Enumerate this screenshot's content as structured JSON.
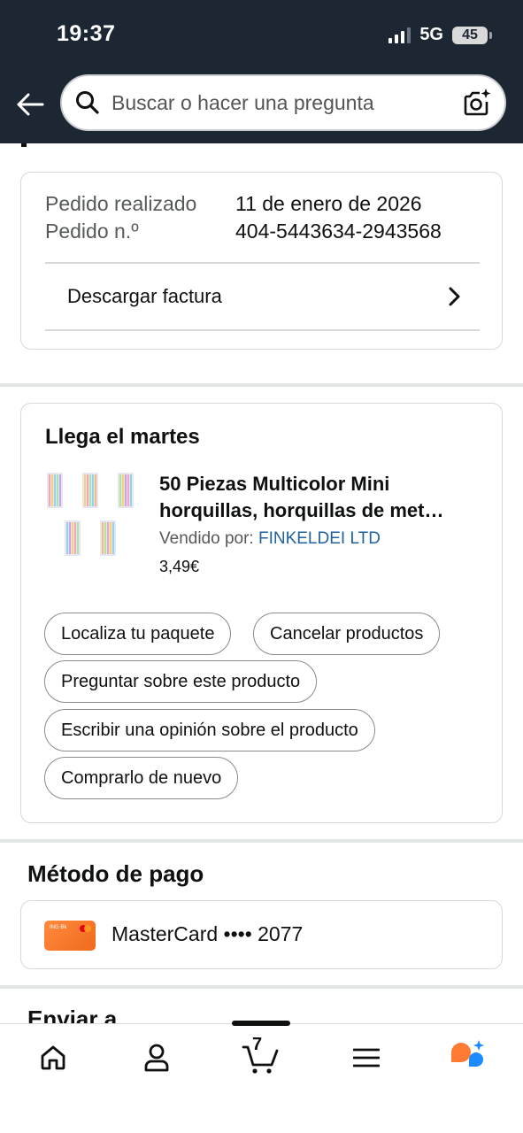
{
  "status_bar": {
    "time": "19:37",
    "network": "5G",
    "battery": "45"
  },
  "header": {
    "search_placeholder": "Buscar o hacer una pregunta"
  },
  "order_info": {
    "placed_label": "Pedido realizado",
    "placed_value": "11 de enero de 2026",
    "number_label": "Pedido n.º",
    "number_value": "404-5443634-2943568",
    "invoice_label": "Descargar factura"
  },
  "shipment": {
    "heading": "Llega el martes",
    "product_title_line1": "50 Piezas Multicolor Mini",
    "product_title_line2": "horquillas, horquillas de met…",
    "seller_label": "Vendido por: ",
    "seller_name": "FINKELDEI LTD",
    "price": "3,49€",
    "actions": [
      "Localiza tu paquete",
      "Cancelar productos",
      "Preguntar sobre este producto",
      "Escribir una opinión sobre el producto",
      "Comprarlo de nuevo"
    ]
  },
  "payment": {
    "heading": "Método de pago",
    "card_label": "MasterCard •••• 2077",
    "card_brand_text": "ING Bk"
  },
  "shipping": {
    "heading": "Enviar a"
  },
  "bottom_nav": {
    "items": [
      "home-icon",
      "account-icon",
      "cart-icon",
      "menu-icon",
      "rufus-icon"
    ],
    "cart_count": "7"
  },
  "colors": {
    "header_bg": "#1d2733",
    "link": "#2162a1",
    "card_accent": "#f06a1c",
    "rufus_orange": "#ff7a33",
    "rufus_blue": "#1a8cff"
  }
}
